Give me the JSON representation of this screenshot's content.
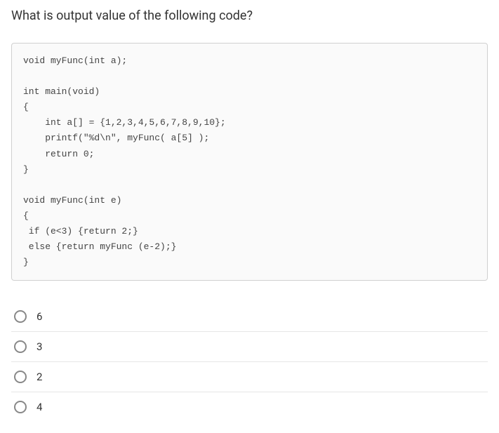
{
  "question": "What is output value of the following code?",
  "code": "void myFunc(int a);\n\nint main(void)\n{\n    int a[] = {1,2,3,4,5,6,7,8,9,10};\n    printf(\"%d\\n\", myFunc( a[5] );\n    return 0;\n}\n\nvoid myFunc(int e)\n{\n if (e<3) {return 2;}\n else {return myFunc (e-2);}\n}",
  "options": [
    "6",
    "3",
    "2",
    "4"
  ]
}
